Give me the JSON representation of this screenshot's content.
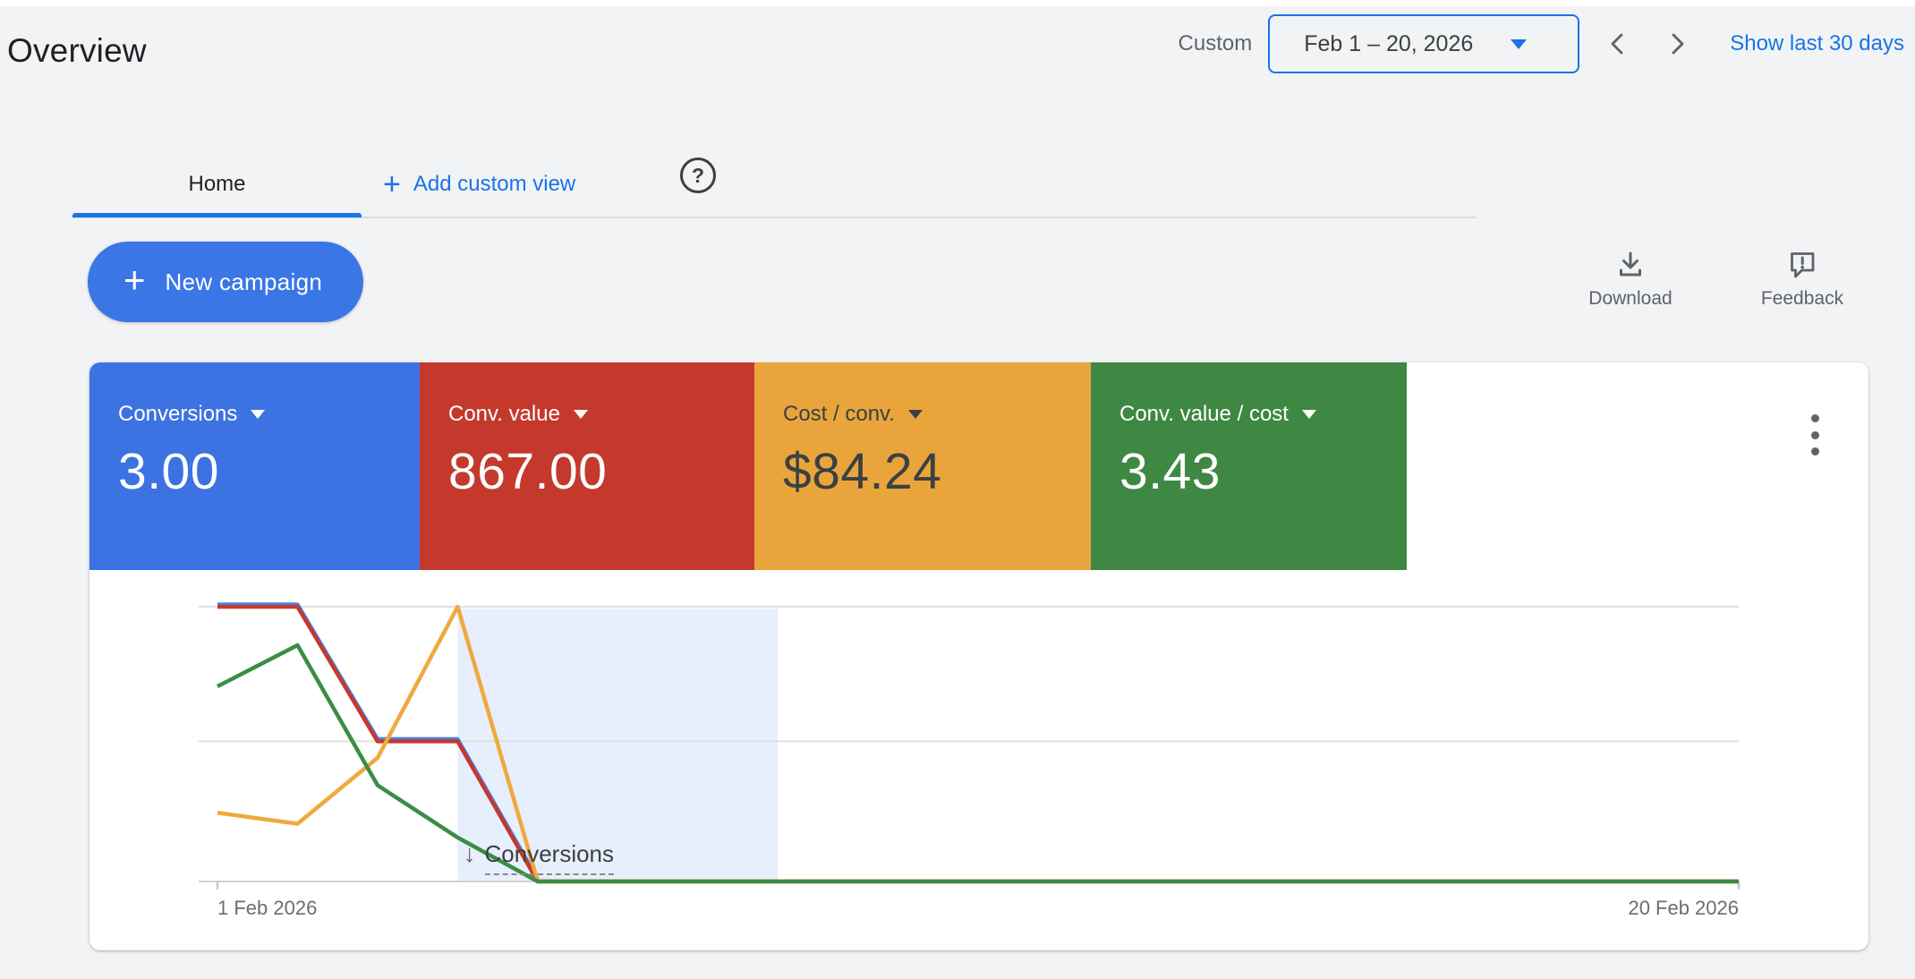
{
  "page": {
    "title": "Overview"
  },
  "date_toolbar": {
    "mode_label": "Custom",
    "range_label": "Feb 1 – 20, 2026",
    "show_last_link": "Show last 30 days"
  },
  "tabs": {
    "home_label": "Home",
    "add_icon": "+",
    "add_custom_view_label": "Add custom view",
    "help_glyph": "?"
  },
  "actions": {
    "new_campaign_icon": "+",
    "new_campaign_label": "New campaign",
    "download_label": "Download",
    "feedback_label": "Feedback"
  },
  "scorecards": [
    {
      "label": "Conversions",
      "value": "3.00",
      "color": "#3d72e2",
      "text_color": "#ffffff"
    },
    {
      "label": "Conv. value",
      "value": "867.00",
      "color": "#c5392d",
      "text_color": "#ffffff"
    },
    {
      "label": "Cost / conv.",
      "value": "$84.24",
      "color": "#e9a53c",
      "text_color": "#3c4043"
    },
    {
      "label": "Conv. value / cost",
      "value": "3.43",
      "color": "#3f8843",
      "text_color": "#ffffff"
    }
  ],
  "icons": {
    "dropdown_arrow": "triangle-down",
    "chevron_left": "angle-left",
    "chevron_right": "angle-right",
    "help": "question-mark-circle",
    "download": "arrow-down-into-tray",
    "feedback": "speech-bubble-exclamation",
    "overflow": "vertical-three-dots"
  },
  "chart_data": {
    "type": "line",
    "title": "",
    "xlabel": "",
    "ylabel": "",
    "x_unit": "day of February 2026",
    "x": [
      1,
      2,
      3,
      4,
      5,
      6,
      7,
      8,
      9,
      10,
      11,
      12,
      13,
      14,
      15,
      16,
      17,
      18,
      19,
      20
    ],
    "x_start_label": "1 Feb 2026",
    "x_end_label": "20 Feb 2026",
    "y_axis_note": "no y-axis labels shown; values are % of plot height (each metric normalized)",
    "ylim": [
      0,
      100
    ],
    "gridlines_pct": [
      0,
      51,
      100
    ],
    "legend": "none (colors match scorecards)",
    "series": [
      {
        "name": "Conversions",
        "color": "#4285f4",
        "values": [
          100,
          100,
          51,
          51,
          0,
          0,
          0,
          0,
          0,
          0,
          0,
          0,
          0,
          0,
          0,
          0,
          0,
          0,
          0,
          0
        ]
      },
      {
        "name": "Conv. value",
        "color": "#c5392d",
        "values": [
          100,
          100,
          51,
          51,
          0,
          0,
          0,
          0,
          0,
          0,
          0,
          0,
          0,
          0,
          0,
          0,
          0,
          0,
          0,
          0
        ]
      },
      {
        "name": "Cost / conv.",
        "color": "#f0a93c",
        "values": [
          25,
          21,
          45,
          100,
          0,
          0,
          0,
          0,
          0,
          0,
          0,
          0,
          0,
          0,
          0,
          0,
          0,
          0,
          0,
          0
        ]
      },
      {
        "name": "Conv. value / cost",
        "color": "#3a8e44",
        "values": [
          71,
          86,
          35,
          16,
          0,
          0,
          0,
          0,
          0,
          0,
          0,
          0,
          0,
          0,
          0,
          0,
          0,
          0,
          0,
          0
        ]
      }
    ],
    "highlight_region": {
      "from_day": 4,
      "to_day": 8,
      "color": "#e8effc"
    },
    "annotation": {
      "day": 4,
      "symbol": "↓",
      "label": "Conversions"
    }
  }
}
